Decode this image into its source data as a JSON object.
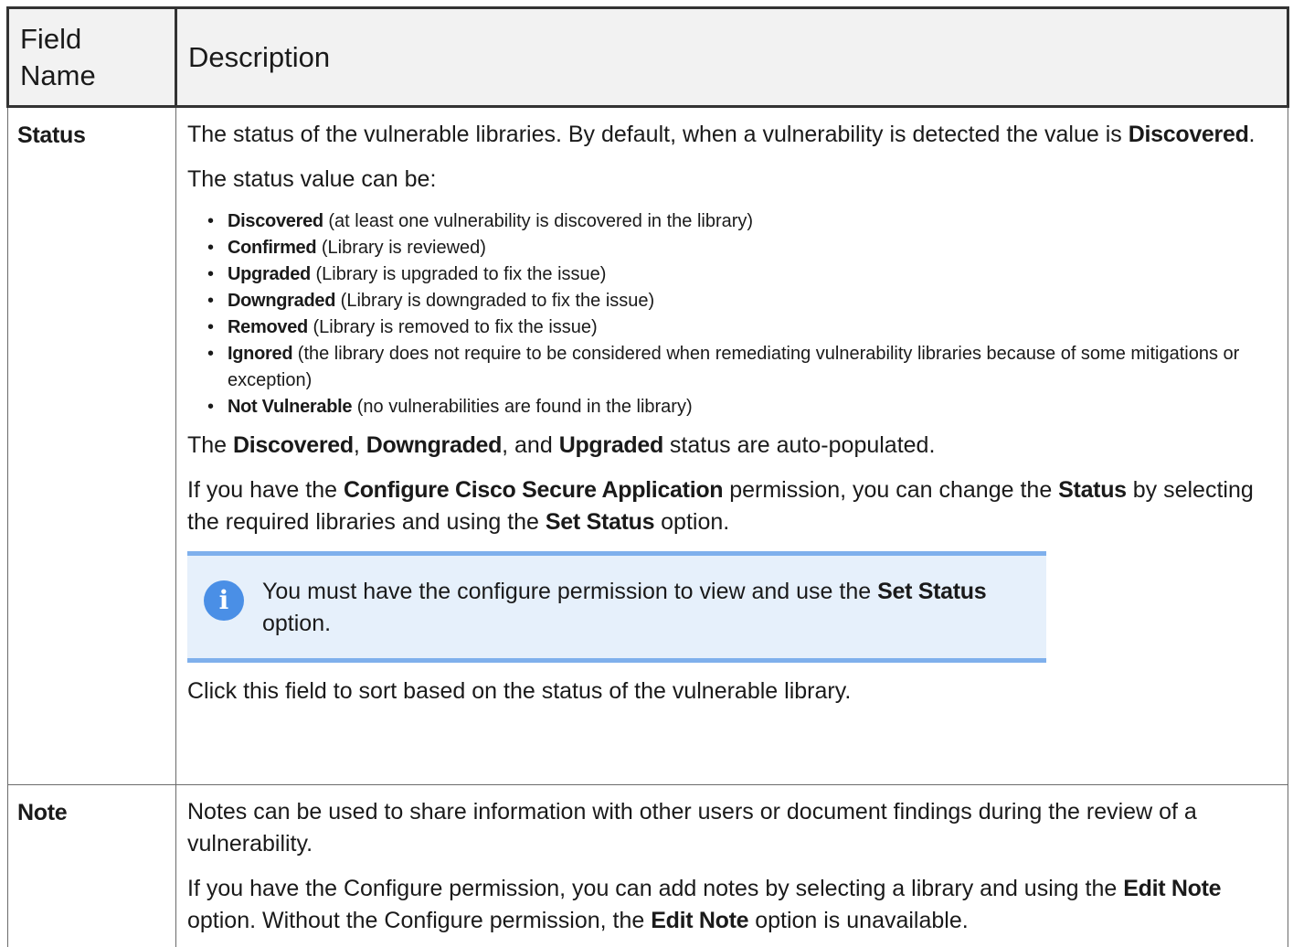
{
  "table": {
    "headers": {
      "field": "Field Name",
      "description": "Description"
    },
    "status_row": {
      "field": "Status",
      "p1_text": "The status of the vulnerable libraries. By default, when a vulnerability is detected the value is ",
      "p1_bold": "Discovered",
      "p1_end": ".",
      "p2": "The status value can be:",
      "list": [
        {
          "bold": "Discovered",
          "text": " (at least one vulnerability is discovered in the library)"
        },
        {
          "bold": "Confirmed",
          "text": " (Library is reviewed)"
        },
        {
          "bold": "Upgraded",
          "text": " (Library is upgraded to fix the issue)"
        },
        {
          "bold": "Downgraded",
          "text": " (Library is downgraded to fix the issue)"
        },
        {
          "bold": "Removed",
          "text": " (Library is removed to fix the issue)"
        },
        {
          "bold": "Ignored",
          "text": " (the library does not require to be considered when remediating vulnerability libraries because of some mitigations or exception)"
        },
        {
          "bold": "Not Vulnerable",
          "text": " (no vulnerabilities are found in the library)"
        }
      ],
      "p3_pre": "The ",
      "p3_b1": "Discovered",
      "p3_sep1": ", ",
      "p3_b2": "Downgraded",
      "p3_sep2": ", and ",
      "p3_b3": "Upgraded",
      "p3_end": " status are auto-populated.",
      "p4_pre": "If you have the ",
      "p4_b1": "Configure Cisco Secure Application",
      "p4_mid1": " permission, you can change the ",
      "p4_b2": "Status",
      "p4_mid2": " by selecting the required libraries and using the ",
      "p4_b3": "Set Status",
      "p4_end": " option.",
      "info_icon": "info-icon",
      "info_pre": "You must have the configure permission to view and use the ",
      "info_bold": "Set Status",
      "info_end": " option.",
      "p5": "Click this field to sort based on the status of the vulnerable library."
    },
    "note_row": {
      "field": "Note",
      "p1": "Notes can be used to share information with other users or document findings during the review of a vulnerability.",
      "p2_pre": "If you have the Configure permission, you can add notes by selecting a library and using the ",
      "p2_b1": "Edit Note",
      "p2_mid": " option. Without the Configure permission, the ",
      "p2_b2": "Edit Note",
      "p2_end": " option is unavailable."
    }
  }
}
